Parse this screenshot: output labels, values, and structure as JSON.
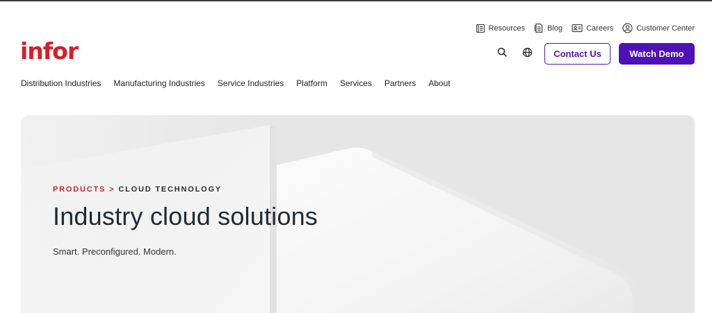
{
  "brand": {
    "logo_text": "infor",
    "logo_color": "#d51e2b",
    "accent_color": "#4e10b8"
  },
  "utility_nav": [
    {
      "label": "Resources",
      "icon": "book-icon"
    },
    {
      "label": "Blog",
      "icon": "document-icon"
    },
    {
      "label": "Careers",
      "icon": "id-card-icon"
    },
    {
      "label": "Customer Center",
      "icon": "user-circle-icon"
    }
  ],
  "header": {
    "search_icon": "search-icon",
    "language_icon": "globe-icon",
    "contact_label": "Contact Us",
    "demo_label": "Watch Demo"
  },
  "main_nav": [
    "Distribution Industries",
    "Manufacturing Industries",
    "Service Industries",
    "Platform",
    "Services",
    "Partners",
    "About"
  ],
  "hero": {
    "breadcrumb_products": "PRODUCTS",
    "breadcrumb_separator": ">",
    "breadcrumb_current": "CLOUD TECHNOLOGY",
    "title": "Industry cloud solutions",
    "subtitle": "Smart. Preconfigured. Modern."
  }
}
